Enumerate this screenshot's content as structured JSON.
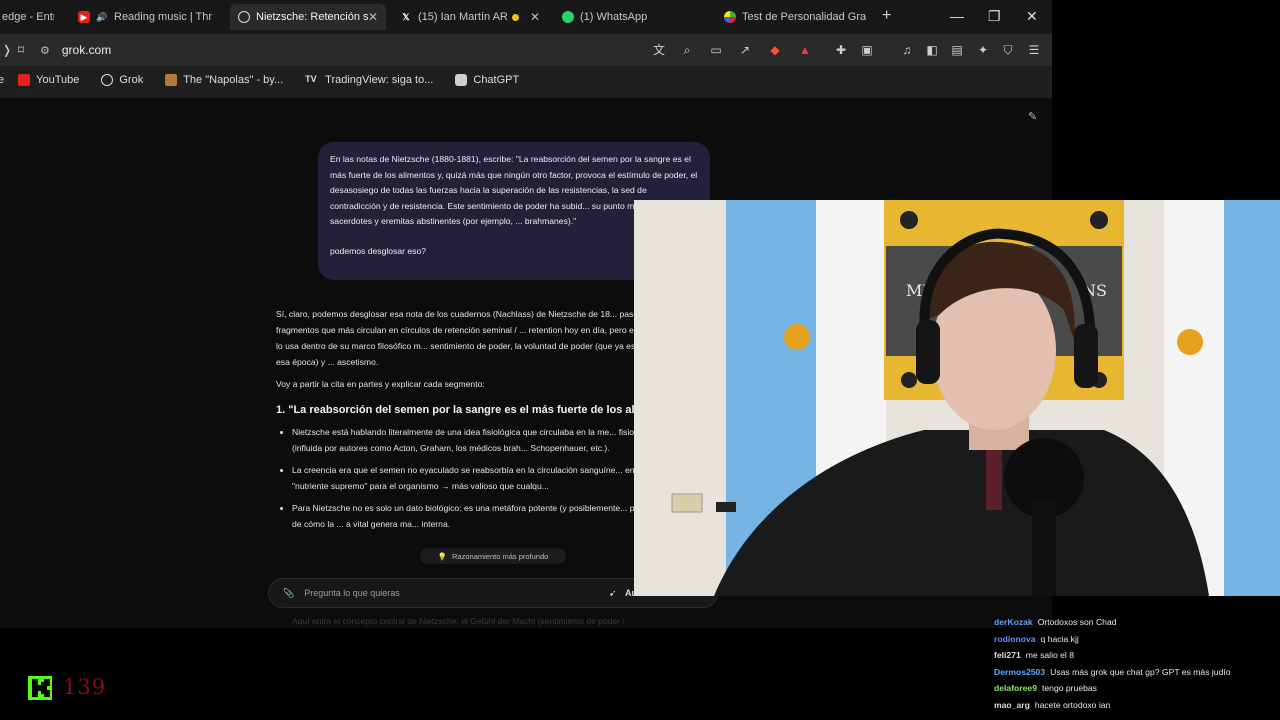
{
  "browser": {
    "tabs": [
      {
        "label": "edge - Entre",
        "active": false
      },
      {
        "label": "Reading music | Thrille",
        "active": false,
        "audio": true
      },
      {
        "label": "Nietzsche: Retención s",
        "active": true
      },
      {
        "label": "(15) Ian Martín AR",
        "active": false
      },
      {
        "label": "(1) WhatsApp",
        "active": false
      },
      {
        "label": "Test de Personalidad Grati",
        "active": false
      }
    ],
    "new_tab": "+",
    "url": "grok.com",
    "bookmarks": [
      {
        "label": "YouTube",
        "color": "#e62117"
      },
      {
        "label": "Grok",
        "color": "#e0e0e0"
      },
      {
        "label": "The \"Napolas\" - by...",
        "color": "#b07a3c"
      },
      {
        "label": "TradingView: siga to...",
        "color": "#dddddd"
      },
      {
        "label": "ChatGPT",
        "color": "#cfcfcf"
      }
    ]
  },
  "grok": {
    "user_message": {
      "p1": "En las notas de Nietzsche (1880-1881), escribe: \"La reabsorción del semen por la sangre es el más fuerte de los alimentos y, quizá más que ningún otro factor, provoca el estímulo de poder, el desasosiego de todas las fuerzas hacia la superación de las resistencias, la sed de contradicción y de resistencia. Este sentimiento de poder ha subid... su punto más alto en los sacerdotes y eremitas abstinentes (por ejemplo, ... brahmanes).\"",
      "p2": "podemos desglosar eso?"
    },
    "answer": {
      "intro": "Sí, claro, podemos desglosar esa nota de los cuadernos (Nachlass) de Nietzsche de 18... paso. Es uno de esos fragmentos que más circulan en círculos de retención seminal / ... retention hoy en día, pero en realidad Nietzsche lo usa dentro de su marco filosófico m... sentimiento de poder, la voluntad de poder (que ya está emergiendo en esa época) y ... ascetismo.",
      "lead": "Voy a partir la cita en partes y explicar cada segmento:",
      "heading": "1. \"La reabsorción del semen por la sangre es el más fuerte de los al",
      "bullets": [
        "Nietzsche está hablando literalmente de una idea fisiológica que circulaba en la me... fisiología del siglo XIX (influida por autores como Acton, Graham, los médicos brah... Schopenhauer, etc.).",
        "La creencia era que el semen no eyaculado se reabsorbía en la circulación sanguíne... en una especie de \"nutriente supremo\" para el organismo → más valioso que cualqu...",
        "Para Nietzsche no es solo un dato biológico: es una metáfora potente (y posiblemente... parcialmente por él) de cómo la ... a vital genera ma... interna."
      ]
    },
    "reasoning_chip": "Razonamiento más profundo",
    "prompt_placeholder": "Pregunta lo que quieras",
    "prompt_mode": "Au",
    "faded_line": "Aquí entra el concepto central de Nietzsche: el Gefühl der Macht (sentimiento de poder /"
  },
  "overlay": {
    "viewer_count": "139",
    "chat": [
      {
        "user": "derKozak",
        "color": "#5aa0ff",
        "text": "Ortodoxos son Chad"
      },
      {
        "user": "rodionova",
        "color": "#6c8cff",
        "text": "q hacia kjj"
      },
      {
        "user": "feli271",
        "color": "#dcdcdc",
        "text": "me salio el 8"
      },
      {
        "user": "Dermos2503",
        "color": "#56b0ff",
        "text": "Usas más grok que chat gp? GPT es más judío"
      },
      {
        "user": "delaforee9",
        "color": "#8fe36b",
        "text": "tengo pruebas"
      },
      {
        "user": "mao_arg",
        "color": "#dcdcdc",
        "text": "hacete ortodoxo ian"
      }
    ]
  },
  "webcam": {
    "banner_text": "MIT",
    "banner_text_right": "NS"
  }
}
